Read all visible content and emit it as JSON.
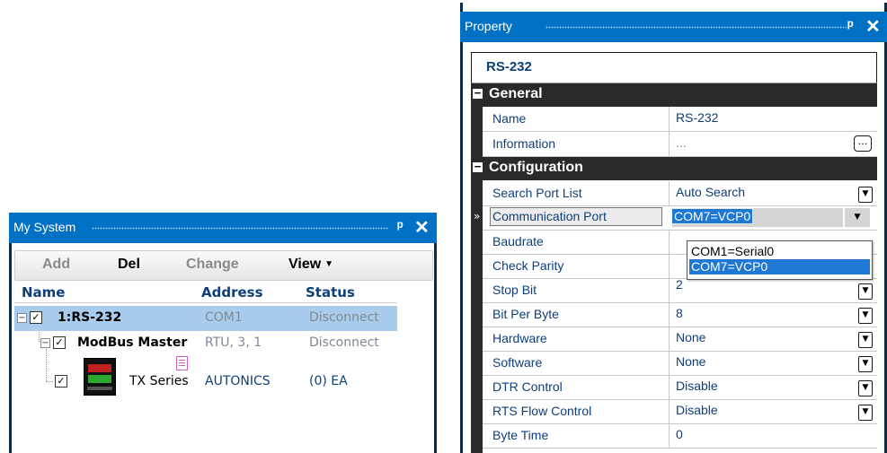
{
  "my_system": {
    "title": "My System",
    "toolbar": {
      "add": "Add",
      "del": "Del",
      "change": "Change",
      "view": "View"
    },
    "columns": {
      "name": "Name",
      "address": "Address",
      "status": "Status"
    },
    "rows": [
      {
        "name": "1:RS-232",
        "address": "COM1",
        "status": "Disconnect"
      },
      {
        "name": "ModBus Master",
        "address": "RTU, 3, 1",
        "status": "Disconnect"
      },
      {
        "name": "TX Series",
        "address": "AUTONICS",
        "status": "(0) EA"
      }
    ]
  },
  "property": {
    "title": "Property",
    "object_name": "RS-232",
    "categories": {
      "general": "General",
      "configuration": "Configuration"
    },
    "general": [
      {
        "name": "Name",
        "value": "RS-232"
      },
      {
        "name": "Information",
        "value": "..."
      }
    ],
    "configuration": [
      {
        "name": "Search Port List",
        "value": "Auto Search"
      },
      {
        "name": "Communication Port",
        "value": "COM7=VCP0"
      },
      {
        "name": "Baudrate",
        "value": ""
      },
      {
        "name": "Check Parity",
        "value": ""
      },
      {
        "name": "Stop Bit",
        "value": "2"
      },
      {
        "name": "Bit Per Byte",
        "value": "8"
      },
      {
        "name": "Hardware",
        "value": "None"
      },
      {
        "name": "Software",
        "value": "None"
      },
      {
        "name": "DTR Control",
        "value": "Disable"
      },
      {
        "name": "RTS Flow Control",
        "value": "Disable"
      },
      {
        "name": "Byte Time",
        "value": "0"
      }
    ],
    "port_options": [
      "COM1=Serial0",
      "COM7=VCP0"
    ],
    "selected_option": "COM7=VCP0"
  },
  "icons": {
    "pin": "pin-icon",
    "close": "close-icon",
    "expand": "collapse-icon",
    "checkbox": "checkbox-checked-icon",
    "dropdown": "chevron-down-icon",
    "ellipsis": "ellipsis-button-icon",
    "row_marker": "double-chevron-right-icon"
  },
  "colors": {
    "titlebar": "#0071c5",
    "selection": "#a9ccec",
    "highlight": "#1e78d4",
    "category_band": "#2a2a2a",
    "label_text": "#0f3f79"
  }
}
